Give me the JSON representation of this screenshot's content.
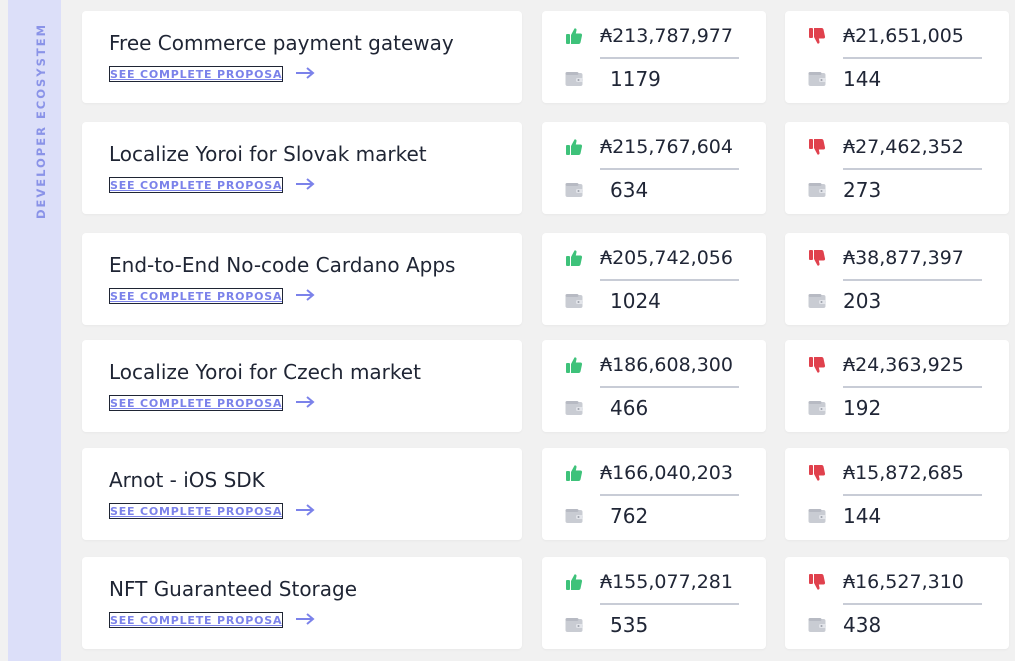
{
  "sidebar": {
    "category_label": "DEVELOPER ECOSYSTEM"
  },
  "link_label": "SEE COMPLETE PROPOSAL",
  "colors": {
    "yes": "#3ec27a",
    "no": "#e0414d",
    "link": "#7b82ea",
    "sidebar_bg": "#dcdff9"
  },
  "proposals": [
    {
      "title": "Free Commerce payment gateway",
      "yes_amount": "₳213,787,977",
      "yes_count": "1179",
      "no_amount": "₳21,651,005",
      "no_count": "144"
    },
    {
      "title": "Localize Yoroi for Slovak market",
      "yes_amount": "₳215,767,604",
      "yes_count": "634",
      "no_amount": "₳27,462,352",
      "no_count": "273"
    },
    {
      "title": "End-to-End No-code Cardano Apps",
      "yes_amount": "₳205,742,056",
      "yes_count": "1024",
      "no_amount": "₳38,877,397",
      "no_count": "203"
    },
    {
      "title": "Localize Yoroi for Czech market",
      "yes_amount": "₳186,608,300",
      "yes_count": "466",
      "no_amount": "₳24,363,925",
      "no_count": "192"
    },
    {
      "title": "Arnot - iOS SDK",
      "yes_amount": "₳166,040,203",
      "yes_count": "762",
      "no_amount": "₳15,872,685",
      "no_count": "144"
    },
    {
      "title": "NFT Guaranteed Storage",
      "yes_amount": "₳155,077,281",
      "yes_count": "535",
      "no_amount": "₳16,527,310",
      "no_count": "438"
    }
  ]
}
